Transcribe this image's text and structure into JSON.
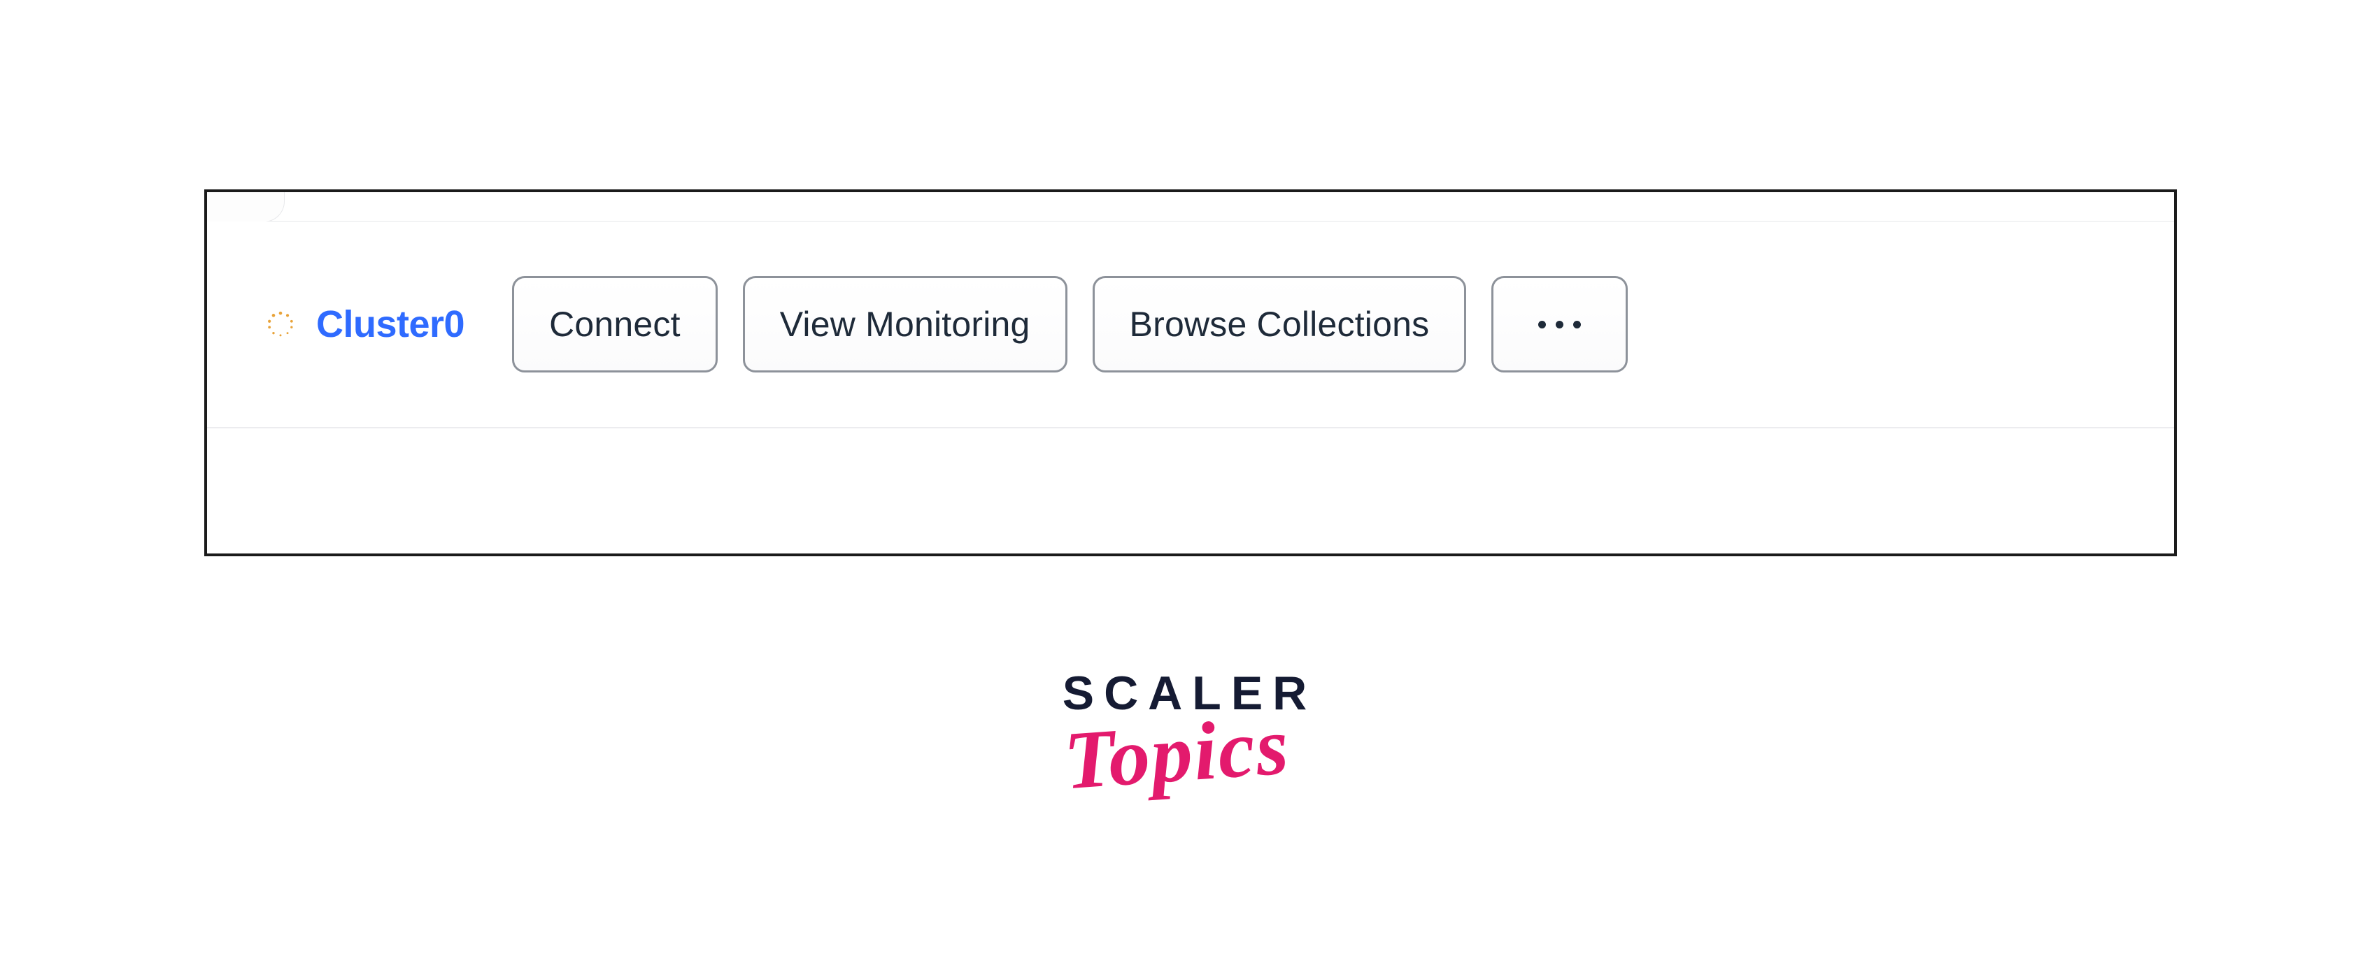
{
  "cluster": {
    "name": "Cluster0",
    "actions": {
      "connect": "Connect",
      "view_monitoring": "View Monitoring",
      "browse_collections": "Browse Collections"
    }
  },
  "brand": {
    "line1": "SCALER",
    "line2": "Topics"
  }
}
